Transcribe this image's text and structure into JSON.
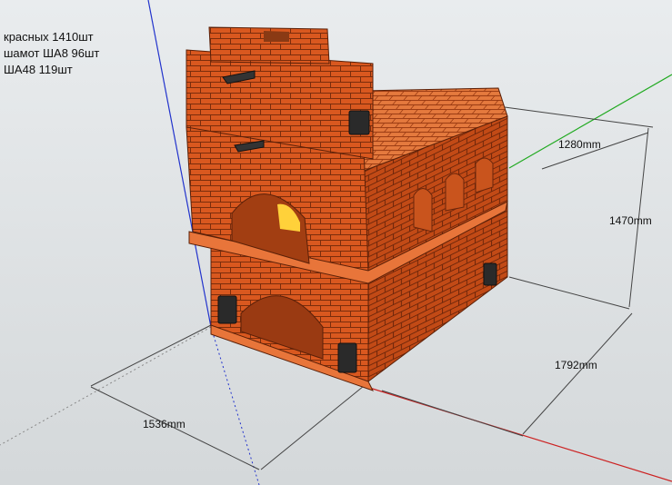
{
  "notes": {
    "line1": "красных 1410шт",
    "line2": "шамот ША8 96шт",
    "line3": "ША48 119шт"
  },
  "dimensions": {
    "width": "1280mm",
    "height": "1470mm",
    "depth": "1792mm",
    "length": "1536mm"
  },
  "colors": {
    "background": "#dde1e3",
    "brick_front": "#d9581f",
    "brick_side": "#c24a16",
    "brick_top": "#e57a3e",
    "mortar": "#7a2d0c",
    "axis_red": "#cc2222",
    "axis_green": "#22aa22",
    "axis_blue": "#2233cc"
  }
}
